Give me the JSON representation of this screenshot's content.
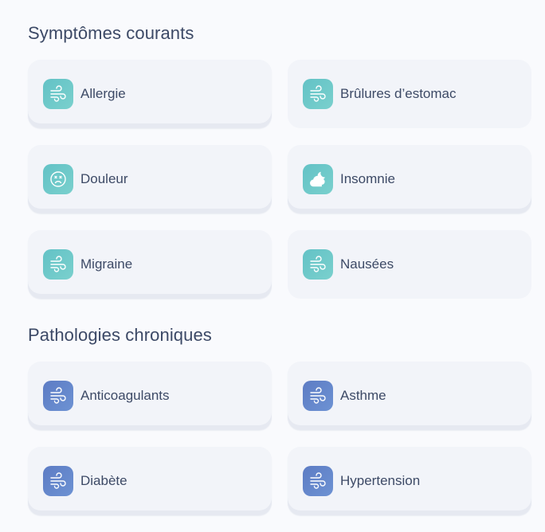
{
  "sections": [
    {
      "title": "Symptômes courants",
      "items": [
        {
          "label": "Allergie",
          "icon": "wind-icon"
        },
        {
          "label": "Brûlures d’estomac",
          "icon": "wind-icon"
        },
        {
          "label": "Douleur",
          "icon": "sad-face-icon"
        },
        {
          "label": "Insomnie",
          "icon": "moon-cloud-icon"
        },
        {
          "label": "Migraine",
          "icon": "wind-icon"
        },
        {
          "label": "Nausées",
          "icon": "wind-icon"
        }
      ]
    },
    {
      "title": "Pathologies chroniques",
      "items": [
        {
          "label": "Anticoagulants",
          "icon": "wind-icon"
        },
        {
          "label": "Asthme",
          "icon": "wind-icon"
        },
        {
          "label": "Diabète",
          "icon": "wind-icon"
        },
        {
          "label": "Hypertension",
          "icon": "wind-icon"
        }
      ]
    }
  ],
  "colors": {
    "symptom_icon_bg": "#6cc8c9",
    "chronic_icon_bg": "#6585cb",
    "card_bg": "#f2f4f9",
    "page_bg": "#f9fafd"
  }
}
